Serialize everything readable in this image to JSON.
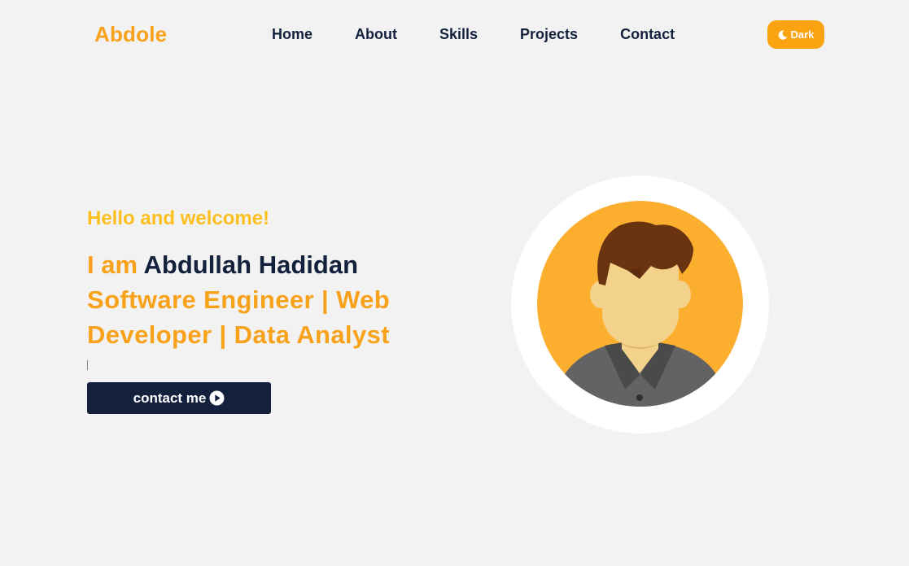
{
  "header": {
    "logo": "Abdole",
    "nav": [
      "Home",
      "About",
      "Skills",
      "Projects",
      "Contact"
    ],
    "theme_toggle": {
      "label": "Dark",
      "icon": "moon-icon"
    }
  },
  "hero": {
    "greeting": "Hello and welcome!",
    "intro": "I am",
    "name": "Abdullah Hadidan",
    "roles": "Software Engineer | Web Developer | Data Analyst",
    "cta": {
      "label": "contact me",
      "icon": "play-circle-icon"
    }
  },
  "avatar": {
    "icon": "person-avatar-illustration"
  },
  "colors": {
    "accent": "#fca311",
    "accent_text": "#f8a21c",
    "greeting": "#fcbf1e",
    "navy": "#14213d",
    "background": "#f2f2f2"
  }
}
